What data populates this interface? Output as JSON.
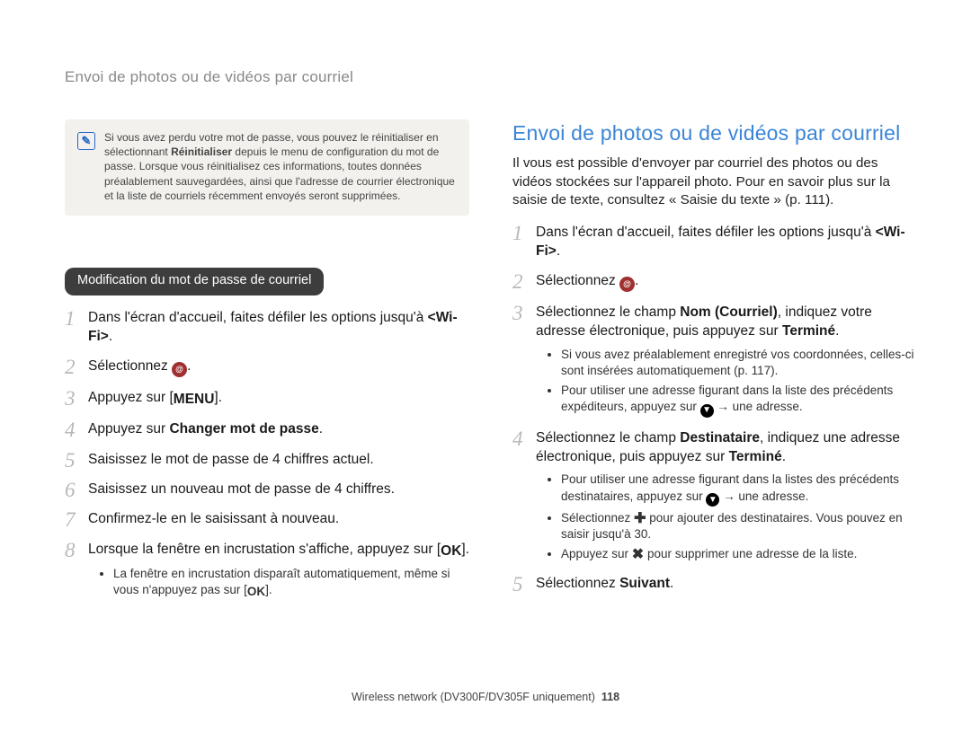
{
  "running_head": "Envoi de photos ou de vidéos par courriel",
  "note": {
    "pre": "Si vous avez perdu votre mot de passe, vous pouvez le réinitialiser en sélectionnant ",
    "bold": "Réinitialiser",
    "post": " depuis le menu de configuration du mot de passe. Lorsque vous réinitialisez ces informations, toutes données préalablement sauvegardées, ainsi que l'adresse de courrier électronique et la liste de courriels récemment envoyés seront supprimées."
  },
  "left": {
    "pill": "Modification du mot de passe de courriel",
    "s1_pre": "Dans l'écran d'accueil, faites défiler les options jusqu'à ",
    "s1_bold": "<Wi-Fi>",
    "s1_post": ".",
    "s2_pre": "Sélectionnez ",
    "s2_post": ".",
    "s3_pre": "Appuyez sur [",
    "s3_btn": "MENU",
    "s3_post": "].",
    "s4_pre": "Appuyez sur ",
    "s4_bold": "Changer mot de passe",
    "s4_post": ".",
    "s5": "Saisissez le mot de passe de 4 chiffres actuel.",
    "s6": "Saisissez un nouveau mot de passe de 4 chiffres.",
    "s7": "Confirmez-le en le saisissant à nouveau.",
    "s8_pre": "Lorsque la fenêtre en incrustation s'affiche, appuyez sur [",
    "s8_btn": "OK",
    "s8_post": "].",
    "s8_sub_pre": "La fenêtre en incrustation disparaît automatiquement, même si vous n'appuyez pas sur [",
    "s8_sub_btn": "OK",
    "s8_sub_post": "]."
  },
  "right": {
    "heading": "Envoi de photos ou de vidéos par courriel",
    "intro": "Il vous est possible d'envoyer par courriel des photos ou des vidéos stockées sur l'appareil photo. Pour en savoir plus sur la saisie de texte, consultez « Saisie du texte » (p. 111).",
    "s1_pre": "Dans l'écran d'accueil, faites défiler les options jusqu'à ",
    "s1_bold": "<Wi-Fi>",
    "s1_post": ".",
    "s2_pre": "Sélectionnez ",
    "s2_post": ".",
    "s3_pre": "Sélectionnez le champ ",
    "s3_bold1": "Nom (Courriel)",
    "s3_mid": ", indiquez votre adresse électronique, puis appuyez sur ",
    "s3_bold2": "Terminé",
    "s3_post": ".",
    "s3_sub1": "Si vous avez préalablement enregistré vos coordonnées, celles-ci sont insérées automatiquement (p. 117).",
    "s3_sub2_pre": "Pour utiliser une adresse figurant dans la liste des précédents expéditeurs, appuyez sur ",
    "s3_sub2_post": " → une adresse.",
    "s4_pre": "Sélectionnez le champ ",
    "s4_bold1": "Destinataire",
    "s4_mid": ", indiquez une adresse électronique, puis appuyez sur ",
    "s4_bold2": "Terminé",
    "s4_post": ".",
    "s4_sub1_pre": "Pour utiliser une adresse figurant dans la listes des précédents destinataires, appuyez sur ",
    "s4_sub1_post": " → une adresse.",
    "s4_sub2_pre": "Sélectionnez ",
    "s4_sub2_post": " pour ajouter des destinataires. Vous pouvez en saisir jusqu'à 30.",
    "s4_sub3_pre": "Appuyez sur ",
    "s4_sub3_post": " pour supprimer une adresse de la liste.",
    "s5_pre": "Sélectionnez ",
    "s5_bold": "Suivant",
    "s5_post": "."
  },
  "footer": {
    "text": "Wireless network (DV300F/DV305F uniquement)",
    "page": "118"
  }
}
